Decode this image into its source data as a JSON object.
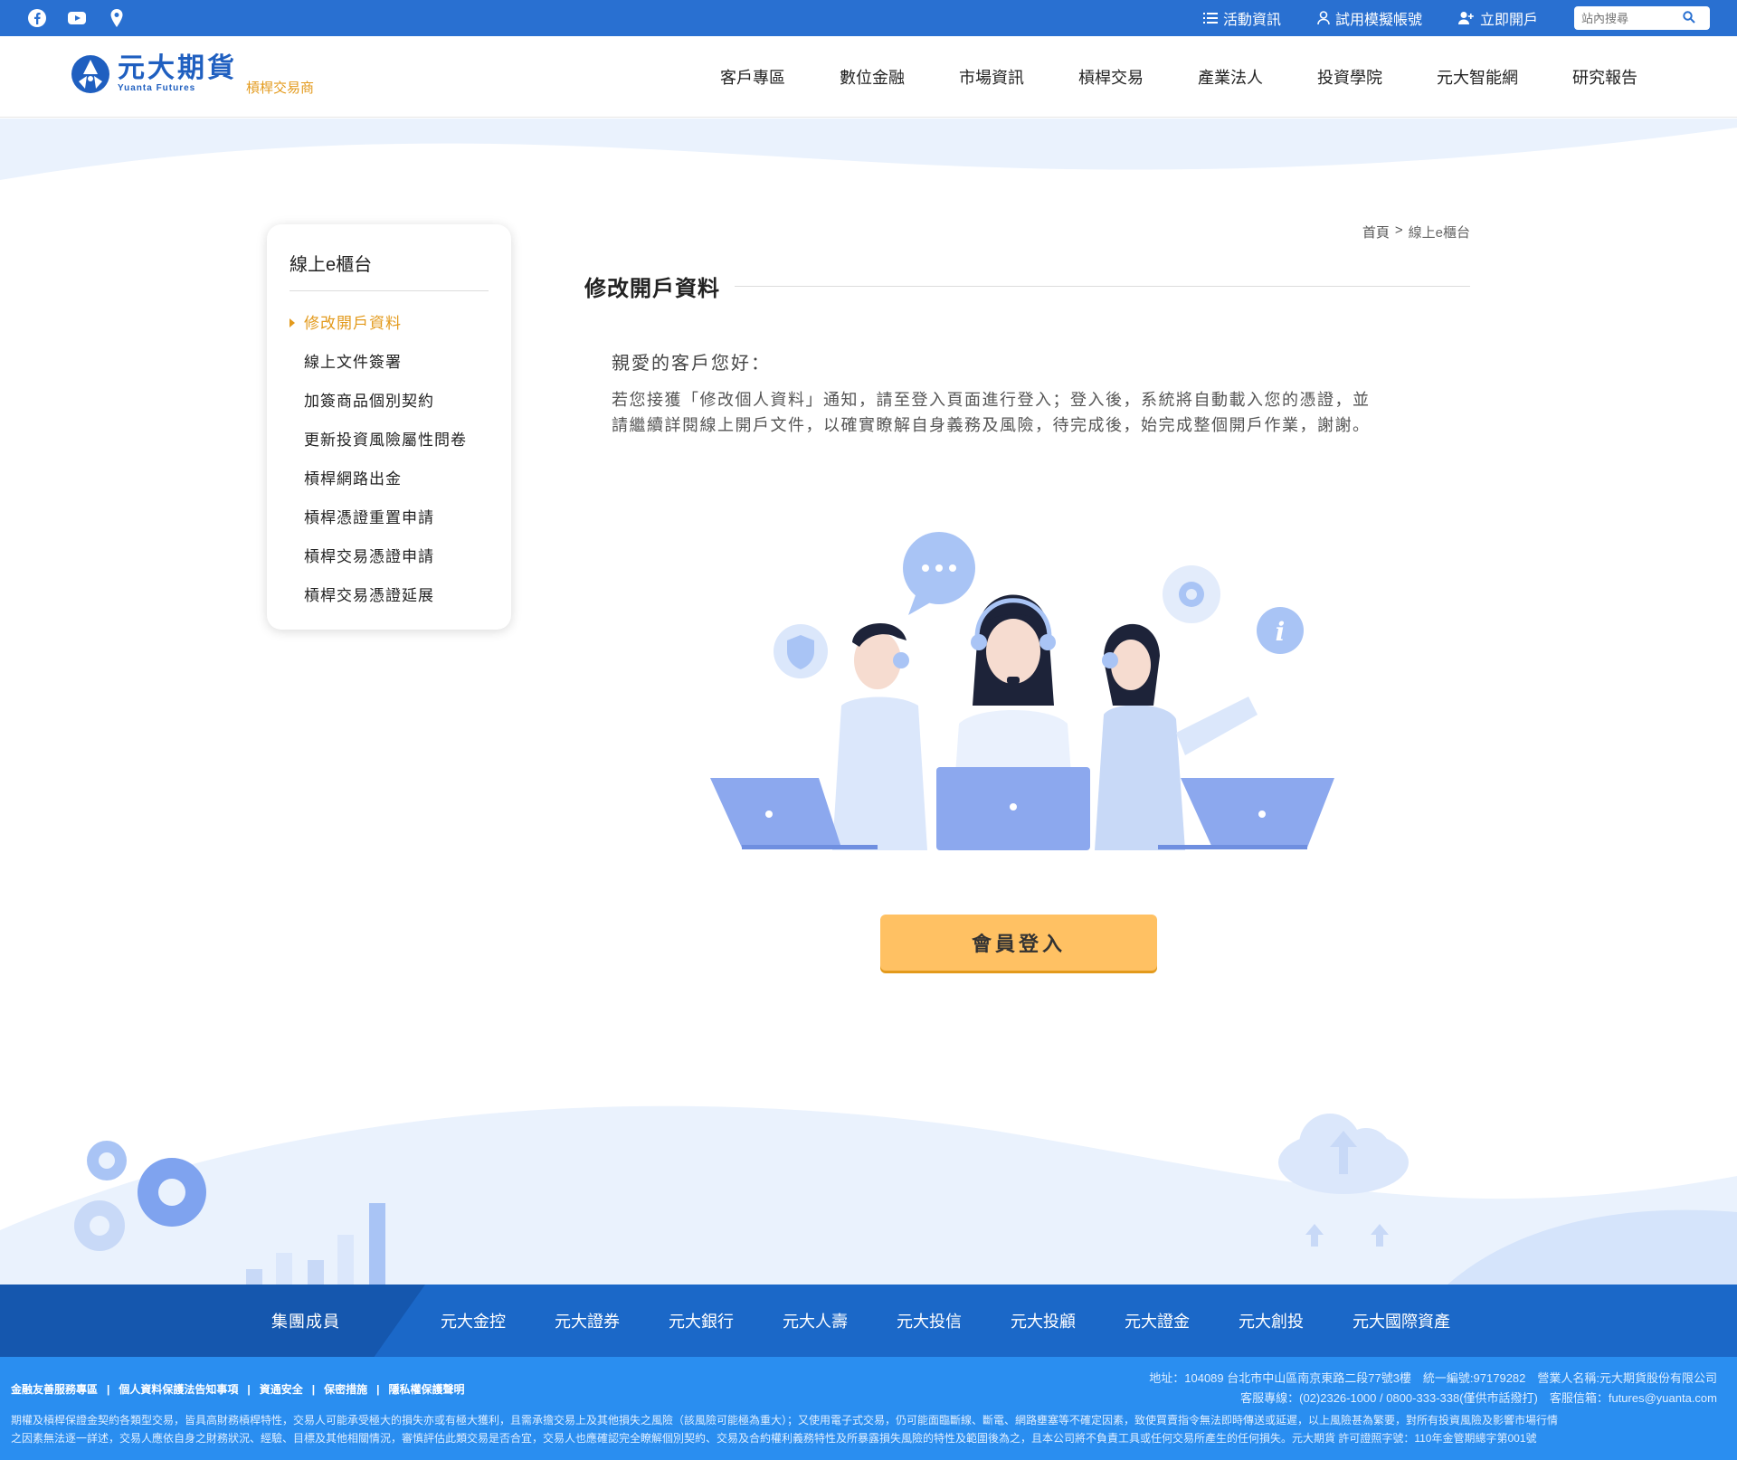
{
  "topbar": {
    "social": [
      "facebook-icon",
      "youtube-icon",
      "location-pin-icon"
    ],
    "links": [
      {
        "label": "活動資訊",
        "icon": "list-icon"
      },
      {
        "label": "試用模擬帳號",
        "icon": "user-icon"
      },
      {
        "label": "立即開戶",
        "icon": "user-plus-icon"
      }
    ],
    "search_placeholder": "站內搜尋"
  },
  "logo": {
    "name_cn": "元大期貨",
    "name_en": "Yuanta Futures",
    "subtitle": "槓桿交易商"
  },
  "nav": [
    "客戶專區",
    "數位金融",
    "市場資訊",
    "槓桿交易",
    "產業法人",
    "投資學院",
    "元大智能網",
    "研究報告"
  ],
  "sidebar": {
    "title": "線上e櫃台",
    "items": [
      {
        "label": "修改開戶資料",
        "active": true
      },
      {
        "label": "線上文件簽署",
        "active": false
      },
      {
        "label": "加簽商品個別契約",
        "active": false
      },
      {
        "label": "更新投資風險屬性問卷",
        "active": false
      },
      {
        "label": "槓桿網路出金",
        "active": false
      },
      {
        "label": "槓桿憑證重置申請",
        "active": false
      },
      {
        "label": "槓桿交易憑證申請",
        "active": false
      },
      {
        "label": "槓桿交易憑證延展",
        "active": false
      }
    ]
  },
  "breadcrumb": {
    "home": "首頁",
    "separator": ">",
    "current": "線上e櫃台"
  },
  "content": {
    "title": "修改開戶資料",
    "greeting": "親愛的客戶您好：",
    "message_line1": "若您接獲「修改個人資料」通知，請至登入頁面進行登入；登入後，系統將自動載入您的憑證，並",
    "message_line2": "請繼續詳閱線上開戶文件，以確實瞭解自身義務及風險，待完成後，始完成整個開戶作業，謝謝。",
    "login_button": "會員登入"
  },
  "group": {
    "label": "集團成員",
    "items": [
      "元大金控",
      "元大證券",
      "元大銀行",
      "元大人壽",
      "元大投信",
      "元大投顧",
      "元大證金",
      "元大創投",
      "元大國際資產"
    ]
  },
  "footer": {
    "links": [
      "金融友善服務專區",
      "個人資料保護法告知事項",
      "資通安全",
      "保密措施",
      "隱私權保護聲明"
    ],
    "address_line": "地址：104089 台北市中山區南京東路二段77號3樓　統一編號:97179282　營業人名稱:元大期貨股份有限公司",
    "contact_line": "客服專線：(02)2326-1000 / 0800-333-338(僅供市話撥打)　客服信箱：futures@yuanta.com",
    "disclaimer_line1": "期權及槓桿保證金契約各類型交易，皆具高財務槓桿特性，交易人可能承受極大的損失亦或有極大獲利，且需承擔交易上及其他損失之風險（該風險可能極為重大）；又使用電子式交易，仍可能面臨斷線、斷電、網路壅塞等不確定因素，致使買賣指令無法即時傳送或延遲，以上風險甚為繁要，對所有投資風險及影響市場行情",
    "disclaimer_line2": "之因素無法逐一詳述，交易人應依自身之財務狀況、經驗、目標及其他相關情況，審慎評估此類交易是否合宜，交易人也應確認完全瞭解個別契約、交易及合約權利義務特性及所暴露損失風險的特性及範圍後為之，且本公司將不負責工具或任何交易所產生的任何損失。元大期貨 許可證照字號：110年金管期總字第001號"
  },
  "colors": {
    "primary_blue": "#2970d1",
    "accent_orange": "#e39a1c",
    "button_yellow": "#ffc163",
    "group_bar": "#1b68c8",
    "footer_blue": "#2a8ef0"
  }
}
